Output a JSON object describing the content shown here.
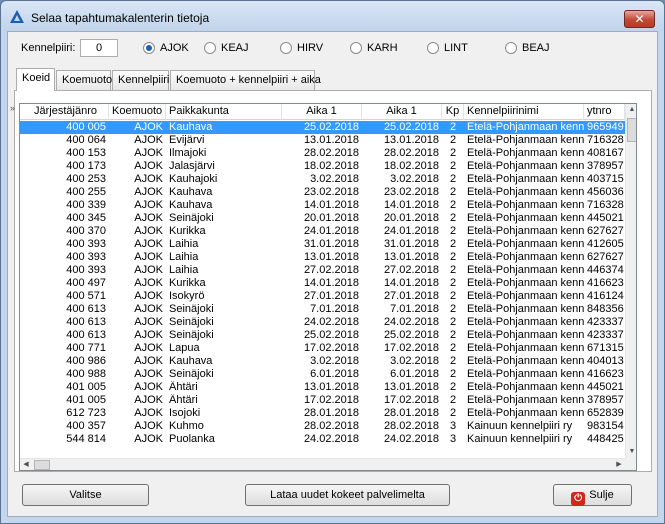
{
  "window": {
    "title": "Selaa tapahtumakalenterin tietoja",
    "close_label": "✕"
  },
  "filter": {
    "kennel_label": "Kennelpiiri:",
    "kennel_value": "0",
    "radios": [
      {
        "label": "AJOK",
        "selected": true
      },
      {
        "label": "KEAJ",
        "selected": false
      },
      {
        "label": "HIRV",
        "selected": false
      },
      {
        "label": "KARH",
        "selected": false
      },
      {
        "label": "LINT",
        "selected": false
      },
      {
        "label": "BEAJ",
        "selected": false
      }
    ]
  },
  "tabs": [
    "Koeid",
    "Koemuoto",
    "Kennelpiiri",
    "Koemuoto + kennelpiiri + aika"
  ],
  "active_tab": 0,
  "table": {
    "headers": [
      "Järjestäjänro",
      "Koemuoto",
      "Paikkakunta",
      "Aika 1",
      "Aika 1",
      "Kp",
      "Kennelpiirinimi",
      "ytnro"
    ],
    "rows": [
      [
        "400 005",
        "AJOK",
        "Kauhava",
        "25.02.2018",
        "25.02.2018",
        "2",
        "Etelä-Pohjanmaan kennelpiiri ry",
        "965949"
      ],
      [
        "400 064",
        "AJOK",
        "Evijärvi",
        "13.01.2018",
        "13.01.2018",
        "2",
        "Etelä-Pohjanmaan kennelpiiri ry",
        "716328"
      ],
      [
        "400 153",
        "AJOK",
        "Ilmajoki",
        "28.02.2018",
        "28.02.2018",
        "2",
        "Etelä-Pohjanmaan kennelpiiri ry",
        "408167"
      ],
      [
        "400 173",
        "AJOK",
        "Jalasjärvi",
        "18.02.2018",
        "18.02.2018",
        "2",
        "Etelä-Pohjanmaan kennelpiiri ry",
        "378957"
      ],
      [
        "400 253",
        "AJOK",
        "Kauhajoki",
        "3.02.2018",
        "3.02.2018",
        "2",
        "Etelä-Pohjanmaan kennelpiiri ry",
        "403715"
      ],
      [
        "400 255",
        "AJOK",
        "Kauhava",
        "23.02.2018",
        "23.02.2018",
        "2",
        "Etelä-Pohjanmaan kennelpiiri ry",
        "456036"
      ],
      [
        "400 339",
        "AJOK",
        "Kauhava",
        "14.01.2018",
        "14.01.2018",
        "2",
        "Etelä-Pohjanmaan kennelpiiri ry",
        "716328"
      ],
      [
        "400 345",
        "AJOK",
        "Seinäjoki",
        "20.01.2018",
        "20.01.2018",
        "2",
        "Etelä-Pohjanmaan kennelpiiri ry",
        "445021"
      ],
      [
        "400 370",
        "AJOK",
        "Kurikka",
        "24.01.2018",
        "24.01.2018",
        "2",
        "Etelä-Pohjanmaan kennelpiiri ry",
        "627627"
      ],
      [
        "400 393",
        "AJOK",
        "Laihia",
        "31.01.2018",
        "31.01.2018",
        "2",
        "Etelä-Pohjanmaan kennelpiiri ry",
        "412605"
      ],
      [
        "400 393",
        "AJOK",
        "Laihia",
        "13.01.2018",
        "13.01.2018",
        "2",
        "Etelä-Pohjanmaan kennelpiiri ry",
        "627627"
      ],
      [
        "400 393",
        "AJOK",
        "Laihia",
        "27.02.2018",
        "27.02.2018",
        "2",
        "Etelä-Pohjanmaan kennelpiiri ry",
        "446374"
      ],
      [
        "400 497",
        "AJOK",
        "Kurikka",
        "14.01.2018",
        "14.01.2018",
        "2",
        "Etelä-Pohjanmaan kennelpiiri ry",
        "416623"
      ],
      [
        "400 571",
        "AJOK",
        "Isokyrö",
        "27.01.2018",
        "27.01.2018",
        "2",
        "Etelä-Pohjanmaan kennelpiiri ry",
        "416124"
      ],
      [
        "400 613",
        "AJOK",
        "Seinäjoki",
        "7.01.2018",
        "7.01.2018",
        "2",
        "Etelä-Pohjanmaan kennelpiiri ry",
        "848356"
      ],
      [
        "400 613",
        "AJOK",
        "Seinäjoki",
        "24.02.2018",
        "24.02.2018",
        "2",
        "Etelä-Pohjanmaan kennelpiiri ry",
        "423337"
      ],
      [
        "400 613",
        "AJOK",
        "Seinäjoki",
        "25.02.2018",
        "25.02.2018",
        "2",
        "Etelä-Pohjanmaan kennelpiiri ry",
        "423337"
      ],
      [
        "400 771",
        "AJOK",
        "Lapua",
        "17.02.2018",
        "17.02.2018",
        "2",
        "Etelä-Pohjanmaan kennelpiiri ry",
        "671315"
      ],
      [
        "400 986",
        "AJOK",
        "Kauhava",
        "3.02.2018",
        "3.02.2018",
        "2",
        "Etelä-Pohjanmaan kennelpiiri ry",
        "404013"
      ],
      [
        "400 988",
        "AJOK",
        "Seinäjoki",
        "6.01.2018",
        "6.01.2018",
        "2",
        "Etelä-Pohjanmaan kennelpiiri ry",
        "416623"
      ],
      [
        "401 005",
        "AJOK",
        "Ähtäri",
        "13.01.2018",
        "13.01.2018",
        "2",
        "Etelä-Pohjanmaan kennelpiiri ry",
        "445021"
      ],
      [
        "401 005",
        "AJOK",
        "Ähtäri",
        "17.02.2018",
        "17.02.2018",
        "2",
        "Etelä-Pohjanmaan kennelpiiri ry",
        "378957"
      ],
      [
        "612 723",
        "AJOK",
        "Isojoki",
        "28.01.2018",
        "28.01.2018",
        "2",
        "Etelä-Pohjanmaan kennelpiiri ry",
        "652839"
      ],
      [
        "400 357",
        "AJOK",
        "Kuhmo",
        "28.02.2018",
        "28.02.2018",
        "3",
        "Kainuun kennelpiiri ry",
        "983154"
      ],
      [
        "544 814",
        "AJOK",
        "Puolanka",
        "24.02.2018",
        "24.02.2018",
        "3",
        "Kainuun kennelpiiri ry",
        "448425"
      ]
    ],
    "selected_row": 0
  },
  "buttons": {
    "select_label": "Valitse",
    "load_label": "Lataa uudet kokeet palvelimelta",
    "close_label": "Sulje"
  },
  "colors": {
    "selection": "#3399ff",
    "close_red": "#c24a36",
    "app_icon": "#1b5fb4"
  }
}
